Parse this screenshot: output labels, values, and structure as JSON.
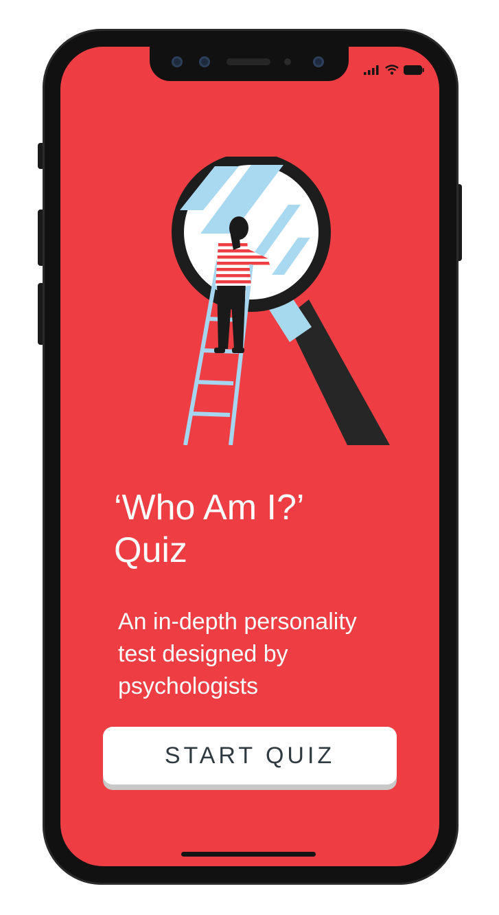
{
  "quiz": {
    "title_line1": "‘Who Am I?’",
    "title_line2": "Quiz",
    "subtitle_line1": "An in-depth personality",
    "subtitle_line2": "test designed by",
    "subtitle_line3": "psychologists",
    "start_button_label": "START QUIZ"
  },
  "icons": {
    "status": [
      "signal-icon",
      "wifi-icon",
      "battery-icon"
    ],
    "illustration": "magnifying-glass-ladder-illustration"
  },
  "colors": {
    "background": "#ee3e44",
    "button": "#ffffff",
    "button_text": "#2f3a40",
    "text": "#ffffff"
  }
}
